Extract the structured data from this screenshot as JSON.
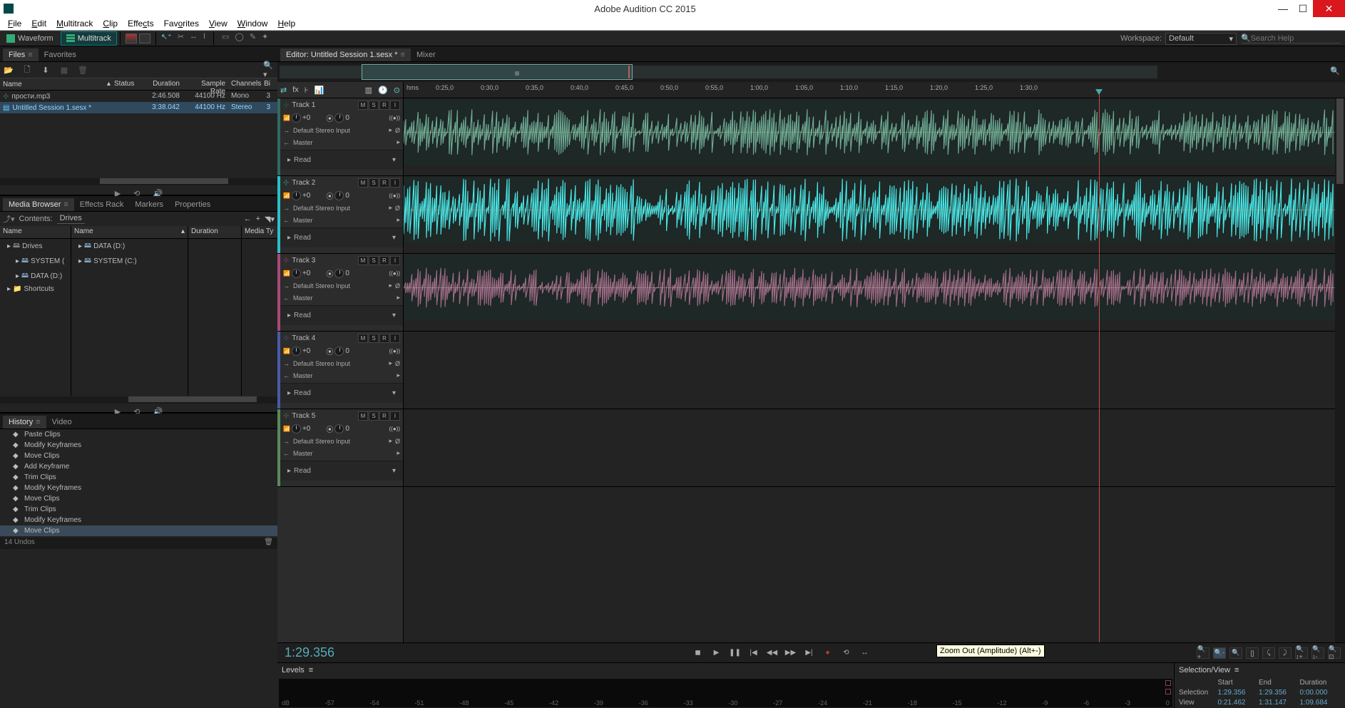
{
  "window": {
    "title": "Adobe Audition CC 2015"
  },
  "menu": [
    "File",
    "Edit",
    "Multitrack",
    "Clip",
    "Effects",
    "Favorites",
    "View",
    "Window",
    "Help"
  ],
  "toolbar": {
    "waveform_label": "Waveform",
    "multitrack_label": "Multitrack",
    "workspace_label": "Workspace:",
    "workspace_value": "Default",
    "search_placeholder": "Search Help"
  },
  "panels": {
    "files_tab": "Files",
    "favorites_tab": "Favorites",
    "media_browser_tab": "Media Browser",
    "effects_rack_tab": "Effects Rack",
    "markers_tab": "Markers",
    "properties_tab": "Properties",
    "history_tab": "History",
    "video_tab": "Video",
    "editor_tab": "Editor: Untitled Session 1.sesx *",
    "mixer_tab": "Mixer",
    "levels_tab": "Levels",
    "selview_tab": "Selection/View"
  },
  "files": {
    "cols": {
      "name": "Name",
      "status": "Status",
      "duration": "Duration",
      "sr": "Sample Rate",
      "ch": "Channels",
      "bi": "Bi"
    },
    "rows": [
      {
        "name": "прости.mp3",
        "duration": "2:46.508",
        "sr": "44100 Hz",
        "ch": "Mono",
        "bi": "3"
      },
      {
        "name": "Untitled Session 1.sesx *",
        "duration": "3:38.042",
        "sr": "44100 Hz",
        "ch": "Stereo",
        "bi": "3"
      }
    ]
  },
  "media": {
    "contents_label": "Contents:",
    "contents_value": "Drives",
    "cols": {
      "name": "Name",
      "duration": "Duration",
      "media_ty": "Media Ty"
    },
    "left_tree": [
      {
        "label": "Drives",
        "expanded": true
      },
      {
        "label": "SYSTEM (",
        "indent": true
      },
      {
        "label": "DATA (D:)",
        "indent": true
      },
      {
        "label": "Shortcuts"
      }
    ],
    "right_tree": [
      {
        "label": "DATA (D:)"
      },
      {
        "label": "SYSTEM (C:)"
      }
    ]
  },
  "history": {
    "items": [
      "Paste Clips",
      "Modify Keyframes",
      "Move Clips",
      "Add Keyframe",
      "Trim Clips",
      "Modify Keyframes",
      "Move Clips",
      "Trim Clips",
      "Modify Keyframes",
      "Move Clips"
    ],
    "status": "14 Undos"
  },
  "timeline": {
    "ruler_unit": "hms",
    "ticks": [
      "0:25,0",
      "0:30,0",
      "0:35,0",
      "0:40,0",
      "0:45,0",
      "0:50,0",
      "0:55,0",
      "1:00,0",
      "1:05,0",
      "1:10,0",
      "1:15,0",
      "1:20,0",
      "1:25,0",
      "1:30,0"
    ],
    "timecode": "1:29.356",
    "tracks": [
      {
        "name": "Track 1",
        "color": "#2f6b5e",
        "vol": "+0",
        "pan": "0",
        "input": "Default Stereo Input",
        "output": "Master",
        "mode": "Read",
        "clip_color": "#6da993"
      },
      {
        "name": "Track 2",
        "color": "#2ac0c6",
        "vol": "+0",
        "pan": "0",
        "input": "Default Stereo Input",
        "output": "Master",
        "mode": "Read",
        "clip_color": "#49e6e6"
      },
      {
        "name": "Track 3",
        "color": "#a84a77",
        "vol": "+0",
        "pan": "0",
        "input": "Default Stereo Input",
        "output": "Master",
        "mode": "Read",
        "clip_color": "#9e6b86"
      },
      {
        "name": "Track 4",
        "color": "#4a5aa8",
        "vol": "+0",
        "pan": "0",
        "input": "Default Stereo Input",
        "output": "Master",
        "mode": "Read",
        "clip_color": ""
      },
      {
        "name": "Track 5",
        "color": "#5a8a5a",
        "vol": "+0",
        "pan": "0",
        "input": "Default Stereo Input",
        "output": "Master",
        "mode": "Read",
        "clip_color": ""
      }
    ]
  },
  "tooltip": "Zoom Out (Amplitude) (Alt+-)",
  "selview": {
    "headers": {
      "start": "Start",
      "end": "End",
      "duration": "Duration"
    },
    "selection": {
      "label": "Selection",
      "start": "1:29.356",
      "end": "1:29.356",
      "duration": "0:00.000"
    },
    "view": {
      "label": "View",
      "start": "0:21.462",
      "end": "1:31.147",
      "duration": "1:09.684"
    }
  },
  "track_buttons": {
    "m": "M",
    "s": "S",
    "r": "R",
    "i": "I"
  }
}
